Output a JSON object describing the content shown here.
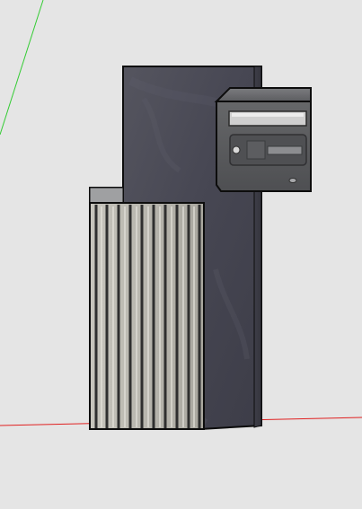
{
  "scene": {
    "background_color": "#e5e5e5",
    "axis_colors": {
      "green": "#33cc33",
      "red": "#e02020"
    },
    "objects": {
      "slate_pillar": {
        "color": "#4a4a55"
      },
      "cladding": {
        "color": "#b8b6ae",
        "slat_color": "#3a3a3a"
      },
      "mailbox": {
        "body_color": "#58595b",
        "slot_color": "#cfcfcf"
      }
    }
  }
}
